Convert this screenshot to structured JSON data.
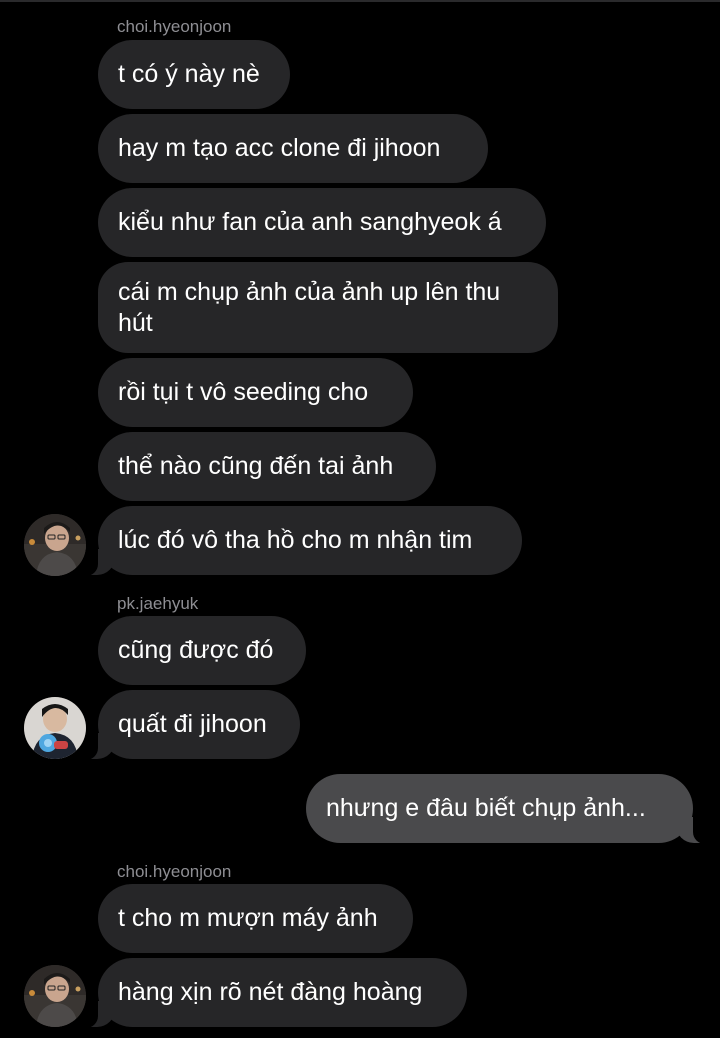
{
  "chat": {
    "messages": [
      {
        "sender": "choi.hyeonjoon",
        "text": "t có ý này nè"
      },
      {
        "text": "hay m tạo acc clone đi jihoon"
      },
      {
        "text": "kiểu như fan của anh sanghyeok á"
      },
      {
        "text": "cái m chụp ảnh của ảnh up lên thu hút"
      },
      {
        "text": "rồi tụi t vô seeding cho"
      },
      {
        "text": "thể nào cũng đến tai ảnh"
      },
      {
        "text": "lúc đó vô tha hồ cho m nhận tim"
      },
      {
        "sender": "pk.jaehyuk",
        "text": "cũng được đó"
      },
      {
        "text": "quất đi jihoon"
      },
      {
        "text": "nhưng e đâu biết chụp ảnh...",
        "outgoing": true
      },
      {
        "sender": "choi.hyeonjoon",
        "text": "t cho m mượn máy ảnh"
      },
      {
        "text": "hàng xịn rõ nét đàng hoàng"
      }
    ]
  },
  "colors": {
    "background": "#000000",
    "incoming_bubble": "#262628",
    "outgoing_bubble": "#4a4a4c",
    "sender_name": "#8e8e93"
  }
}
